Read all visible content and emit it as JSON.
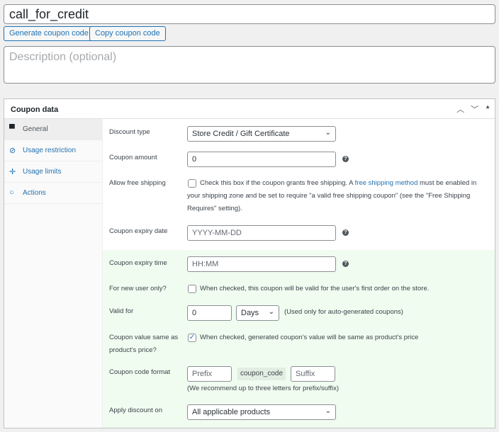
{
  "coupon_code": "call_for_credit",
  "buttons": {
    "generate": "Generate coupon code",
    "copy": "Copy coupon code"
  },
  "description_placeholder": "Description (optional)",
  "panel": {
    "title": "Coupon data"
  },
  "sidebar": {
    "items": [
      {
        "label": "General",
        "icon": "ticket-icon"
      },
      {
        "label": "Usage restriction",
        "icon": "ban-icon"
      },
      {
        "label": "Usage limits",
        "icon": "limits-icon"
      },
      {
        "label": "Actions",
        "icon": "circle-icon"
      }
    ]
  },
  "fields": {
    "discount_type": {
      "label": "Discount type",
      "value": "Store Credit / Gift Certificate"
    },
    "amount": {
      "label": "Coupon amount",
      "value": "0"
    },
    "free_shipping": {
      "label": "Allow free shipping",
      "text_before": "Check this box if the coupon grants free shipping. A ",
      "link": "free shipping method",
      "text_after": " must be enabled in your shipping zone and be set to require \"a valid free shipping coupon\" (see the \"Free Shipping Requires\" setting).",
      "checked": false
    },
    "expiry_date": {
      "label": "Coupon expiry date",
      "placeholder": "YYYY-MM-DD"
    },
    "expiry_time": {
      "label": "Coupon expiry time",
      "placeholder": "HH:MM"
    },
    "new_user": {
      "label": "For new user only?",
      "text": "When checked, this coupon will be valid for the user's first order on the store.",
      "checked": false
    },
    "valid_for": {
      "label": "Valid for",
      "value": "0",
      "unit": "Days",
      "note": "(Used only for auto-generated coupons)"
    },
    "same_price": {
      "label": "Coupon value same as product's price?",
      "text": "When checked, generated coupon's value will be same as product's price",
      "checked": true
    },
    "code_format": {
      "label": "Coupon code format",
      "prefix_placeholder": "Prefix",
      "code": "coupon_code",
      "suffix_placeholder": "Suffix",
      "note": "(We recommend up to three letters for prefix/suffix)"
    },
    "apply_on": {
      "label": "Apply discount on",
      "value": "All applicable products"
    }
  }
}
